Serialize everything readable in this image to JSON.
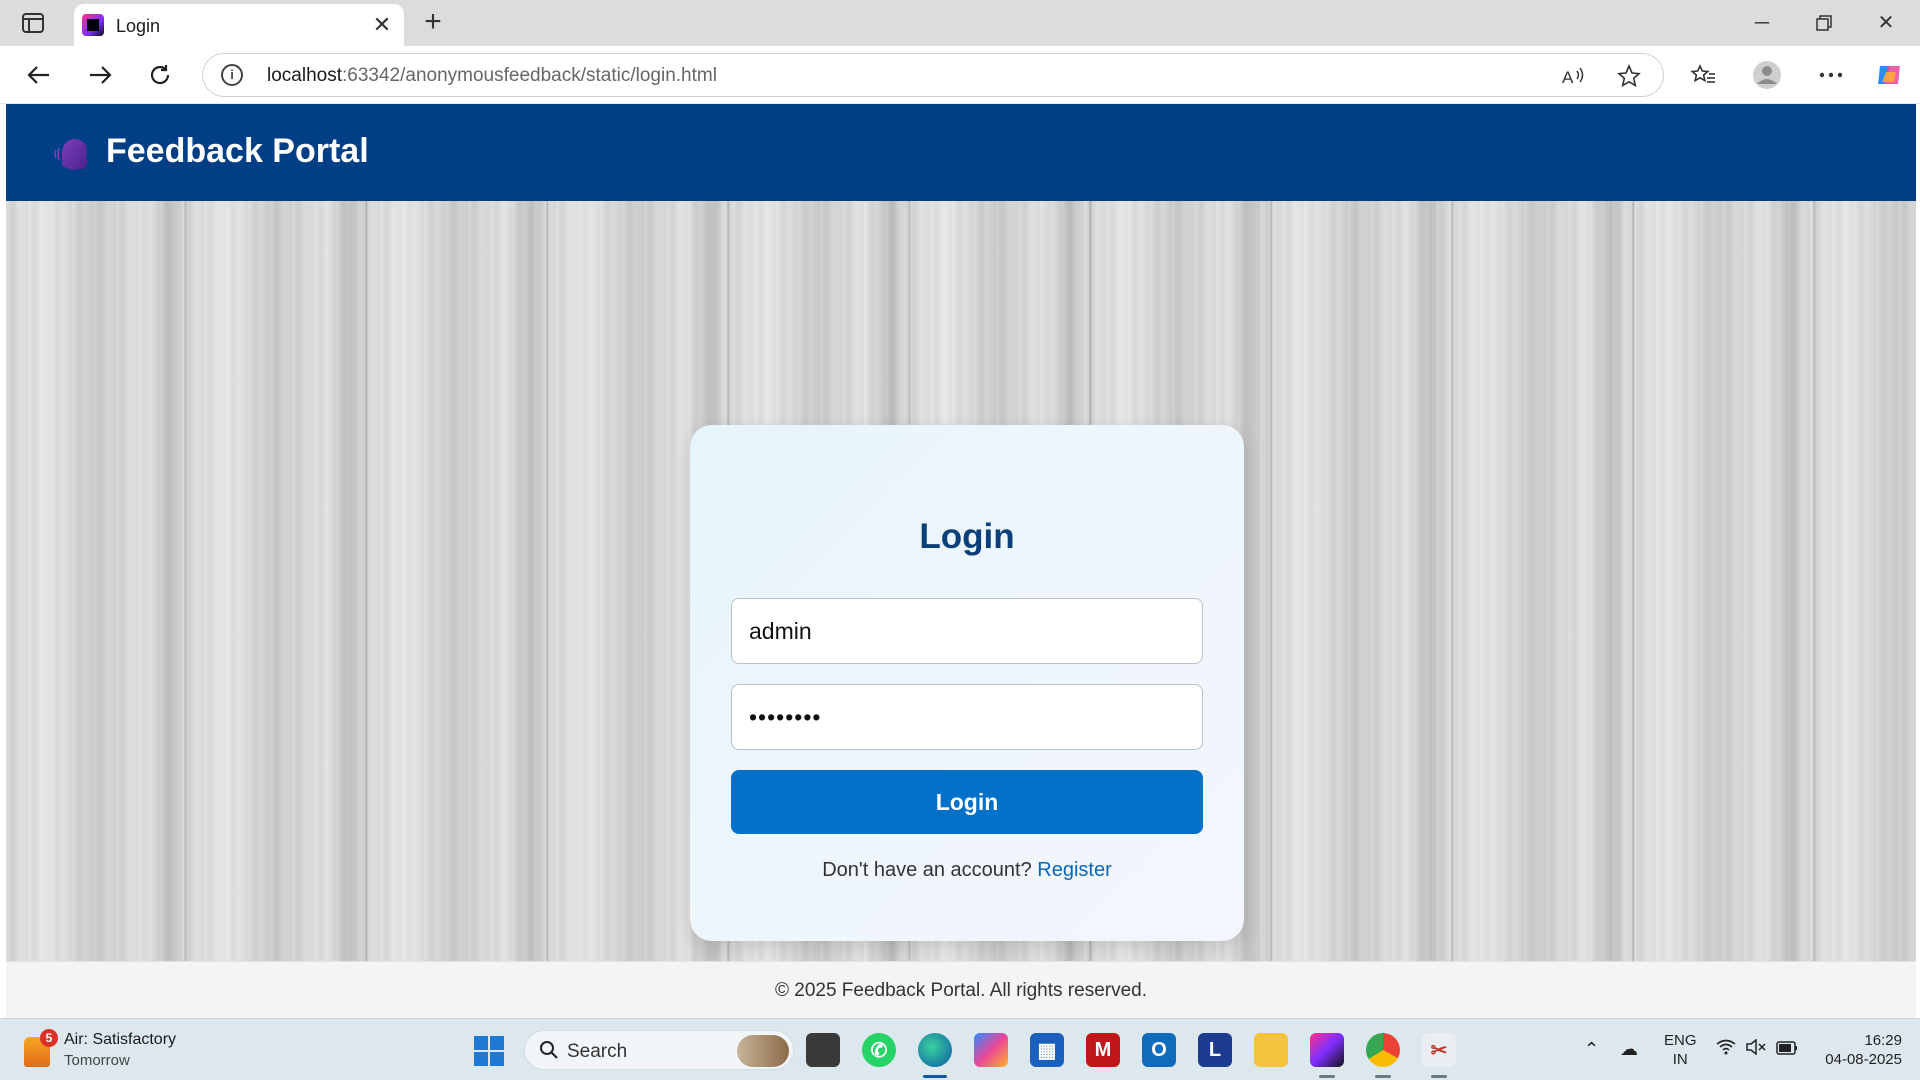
{
  "browser": {
    "tab_title": "Login",
    "url_host": "localhost",
    "url_rest": ":63342/anonymousfeedback/static/login.html"
  },
  "site": {
    "title": "Feedback Portal",
    "footer": "© 2025 Feedback Portal. All rights reserved."
  },
  "login": {
    "heading": "Login",
    "username_value": "admin",
    "password_value": "••••••••",
    "button_label": "Login",
    "register_prompt": "Don't have an account?",
    "register_link": "Register"
  },
  "taskbar": {
    "weather_badge": "5",
    "weather_line1": "Air: Satisfactory",
    "weather_line2": "Tomorrow",
    "search_label": "Search",
    "lang_line1": "ENG",
    "lang_line2": "IN",
    "time": "16:29",
    "date": "04-08-2025"
  },
  "colors": {
    "header": "#003f85",
    "button": "#0070c9",
    "link": "#0b67b8",
    "heading": "#0b3f7a"
  }
}
